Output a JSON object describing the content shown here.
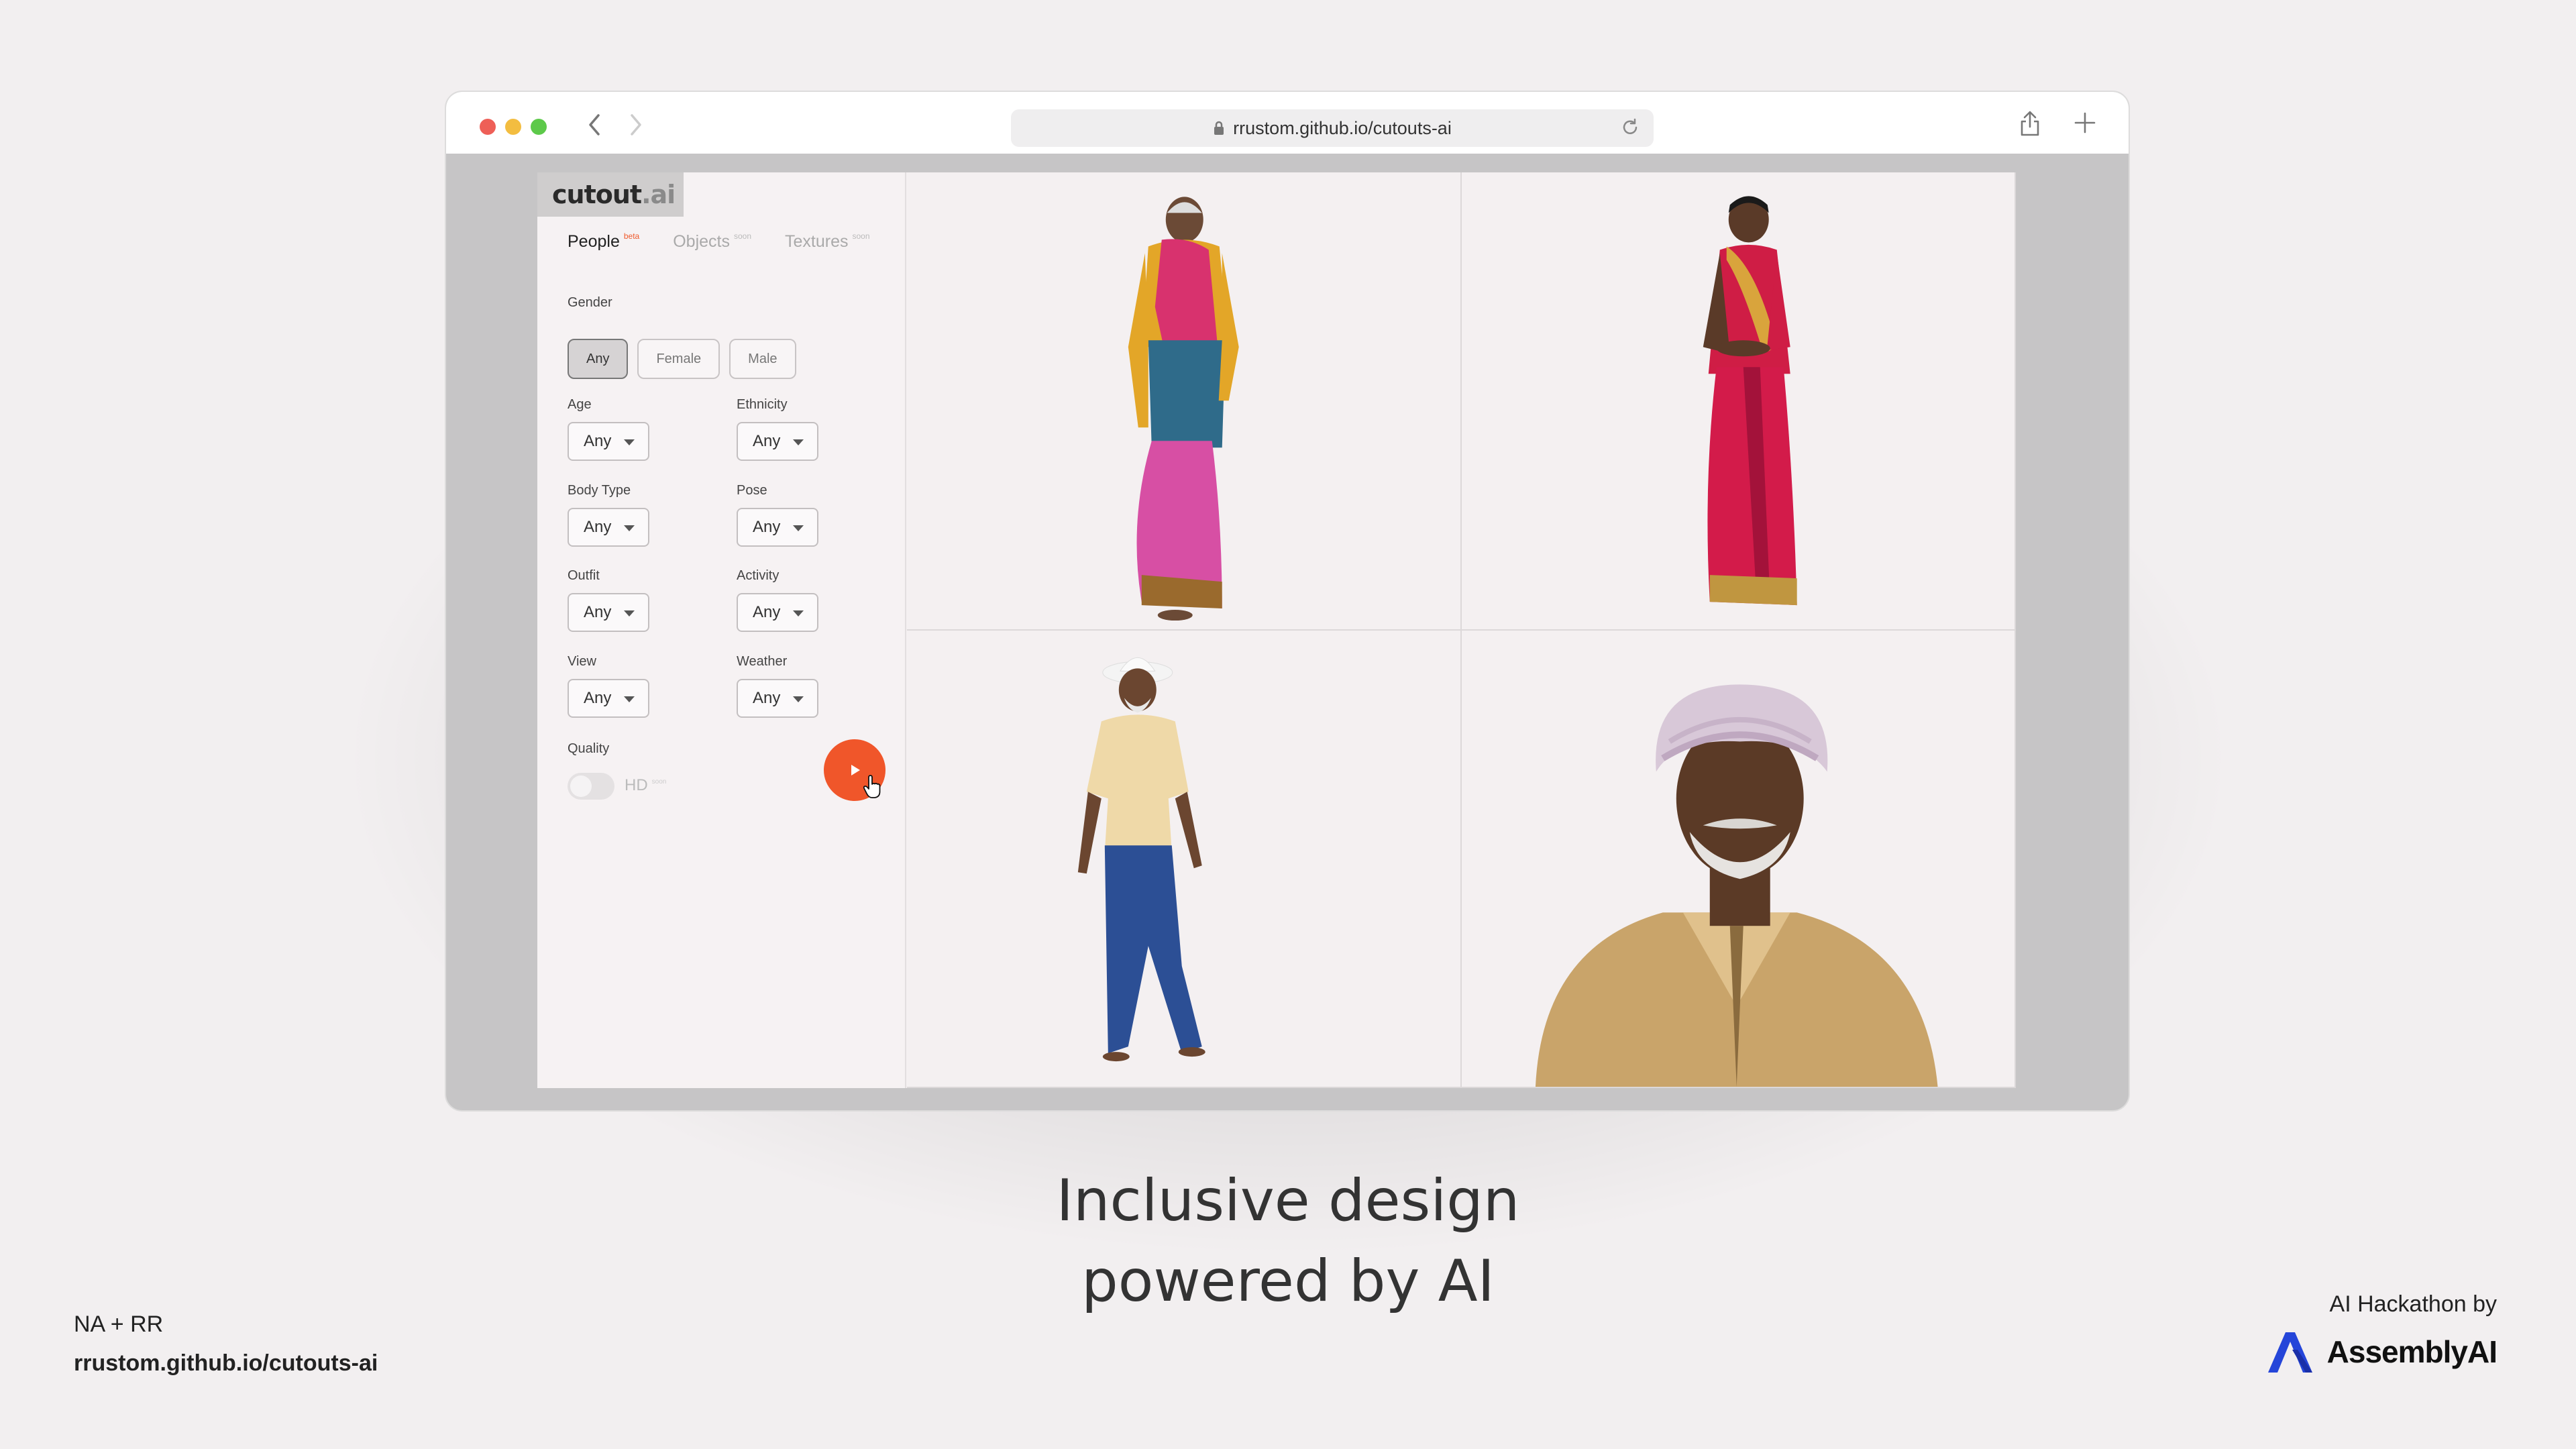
{
  "browser": {
    "url": "rrustom.github.io/cutouts-ai"
  },
  "app": {
    "logo_main": "cutout",
    "logo_suffix": ".ai",
    "tabs": [
      {
        "label": "People",
        "badge": "beta"
      },
      {
        "label": "Objects",
        "badge": "soon"
      },
      {
        "label": "Textures",
        "badge": "soon"
      }
    ],
    "gender": {
      "label": "Gender",
      "options": [
        "Any",
        "Female",
        "Male"
      ],
      "selected": "Any"
    },
    "filters": {
      "age": {
        "label": "Age",
        "value": "Any"
      },
      "ethnicity": {
        "label": "Ethnicity",
        "value": "Any"
      },
      "body_type": {
        "label": "Body Type",
        "value": "Any"
      },
      "pose": {
        "label": "Pose",
        "value": "Any"
      },
      "outfit": {
        "label": "Outfit",
        "value": "Any"
      },
      "activity": {
        "label": "Activity",
        "value": "Any"
      },
      "view": {
        "label": "View",
        "value": "Any"
      },
      "weather": {
        "label": "Weather",
        "value": "Any"
      }
    },
    "quality": {
      "label": "Quality",
      "toggle_label": "HD",
      "toggle_badge": "soon",
      "enabled": false
    },
    "accent_color": "#f0562a",
    "results": [
      {
        "icon": "person-image-elderly-woman-pink-saree"
      },
      {
        "icon": "person-image-woman-red-saree"
      },
      {
        "icon": "person-image-elderly-man-white-hat"
      },
      {
        "icon": "person-image-man-turban-portrait"
      }
    ]
  },
  "slide": {
    "tagline_line1": "Inclusive design",
    "tagline_line2": "powered by AI",
    "authors": "NA + RR",
    "project_url": "rrustom.github.io/cutouts-ai",
    "sponsor_text": "AI Hackathon by",
    "sponsor_brand": "AssemblyAI"
  }
}
